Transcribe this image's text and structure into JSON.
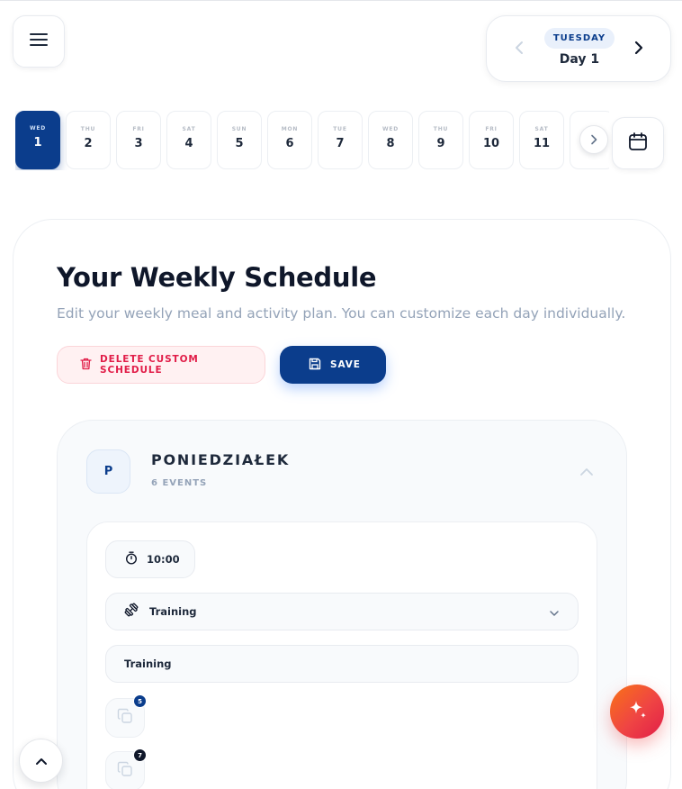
{
  "header": {
    "weekday_badge": "TUESDAY",
    "day_label": "Day 1"
  },
  "date_strip": [
    {
      "dow": "WED",
      "num": "1",
      "active": true
    },
    {
      "dow": "THU",
      "num": "2"
    },
    {
      "dow": "FRI",
      "num": "3"
    },
    {
      "dow": "SAT",
      "num": "4"
    },
    {
      "dow": "SUN",
      "num": "5"
    },
    {
      "dow": "MON",
      "num": "6"
    },
    {
      "dow": "TUE",
      "num": "7"
    },
    {
      "dow": "WED",
      "num": "8"
    },
    {
      "dow": "THU",
      "num": "9"
    },
    {
      "dow": "FRI",
      "num": "10"
    },
    {
      "dow": "SAT",
      "num": "11"
    },
    {
      "dow": "",
      "num": ""
    }
  ],
  "schedule": {
    "title": "Your Weekly Schedule",
    "subtitle": "Edit your weekly meal and activity plan. You can customize each day individually.",
    "delete_label": "DELETE CUSTOM SCHEDULE",
    "save_label": "SAVE"
  },
  "day_section": {
    "avatar_letter": "P",
    "name": "PONIEDZIAŁEK",
    "event_count": "6 EVENTS"
  },
  "event": {
    "time": "10:00",
    "type": "Training",
    "title": "Training",
    "copy_badges": [
      "5",
      "7"
    ]
  },
  "colors": {
    "primary": "#0b3d8c",
    "danger": "#e11d48",
    "ai_gradient_start": "#f97316",
    "ai_gradient_end": "#e11d48"
  },
  "icons": {
    "menu": "hamburger-icon",
    "prev": "chevron-left-icon",
    "next": "chevron-right-icon",
    "calendar": "calendar-icon",
    "delete": "trash-icon",
    "save": "floppy-disk-icon",
    "collapse": "chevron-up-icon",
    "time": "stopwatch-icon",
    "type": "dumbbell-icon",
    "dropdown": "chevron-down-icon",
    "copy": "copy-icon",
    "ai": "sparkle-icon",
    "scroll_top": "chevron-up-icon"
  }
}
